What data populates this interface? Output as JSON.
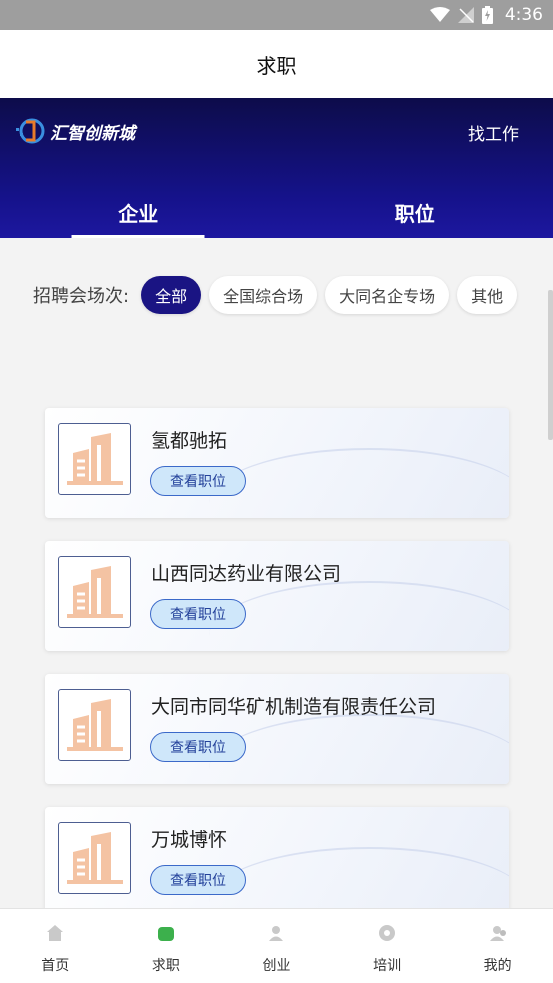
{
  "status_bar": {
    "time": "4:36"
  },
  "header": {
    "title": "求职"
  },
  "hero": {
    "logo_text": "汇智创新城",
    "find_job": "找工作",
    "tabs": [
      {
        "label": "企业",
        "active": true
      },
      {
        "label": "职位",
        "active": false
      }
    ]
  },
  "filters": {
    "label": "招聘会场次:",
    "chips": [
      {
        "label": "全部",
        "active": true
      },
      {
        "label": "全国综合场",
        "active": false
      },
      {
        "label": "大同名企专场",
        "active": false
      },
      {
        "label": "其他",
        "active": false
      }
    ]
  },
  "companies": [
    {
      "name": "氢都驰拓",
      "button": "查看职位"
    },
    {
      "name": "山西同达药业有限公司",
      "button": "查看职位"
    },
    {
      "name": "大同市同华矿机制造有限责任公司",
      "button": "查看职位"
    },
    {
      "name": "万城博怀",
      "button": "查看职位"
    }
  ],
  "bottom_nav": [
    {
      "label": "首页",
      "icon": "home-icon",
      "active": false
    },
    {
      "label": "求职",
      "icon": "job-icon",
      "active": true
    },
    {
      "label": "创业",
      "icon": "startup-icon",
      "active": false
    },
    {
      "label": "培训",
      "icon": "training-icon",
      "active": false
    },
    {
      "label": "我的",
      "icon": "profile-icon",
      "active": false
    }
  ],
  "colors": {
    "accent": "#1a1483",
    "hero_dark": "#0d0c4a",
    "nav_active": "#3cb04c",
    "button_bg": "#cfe7fa"
  }
}
